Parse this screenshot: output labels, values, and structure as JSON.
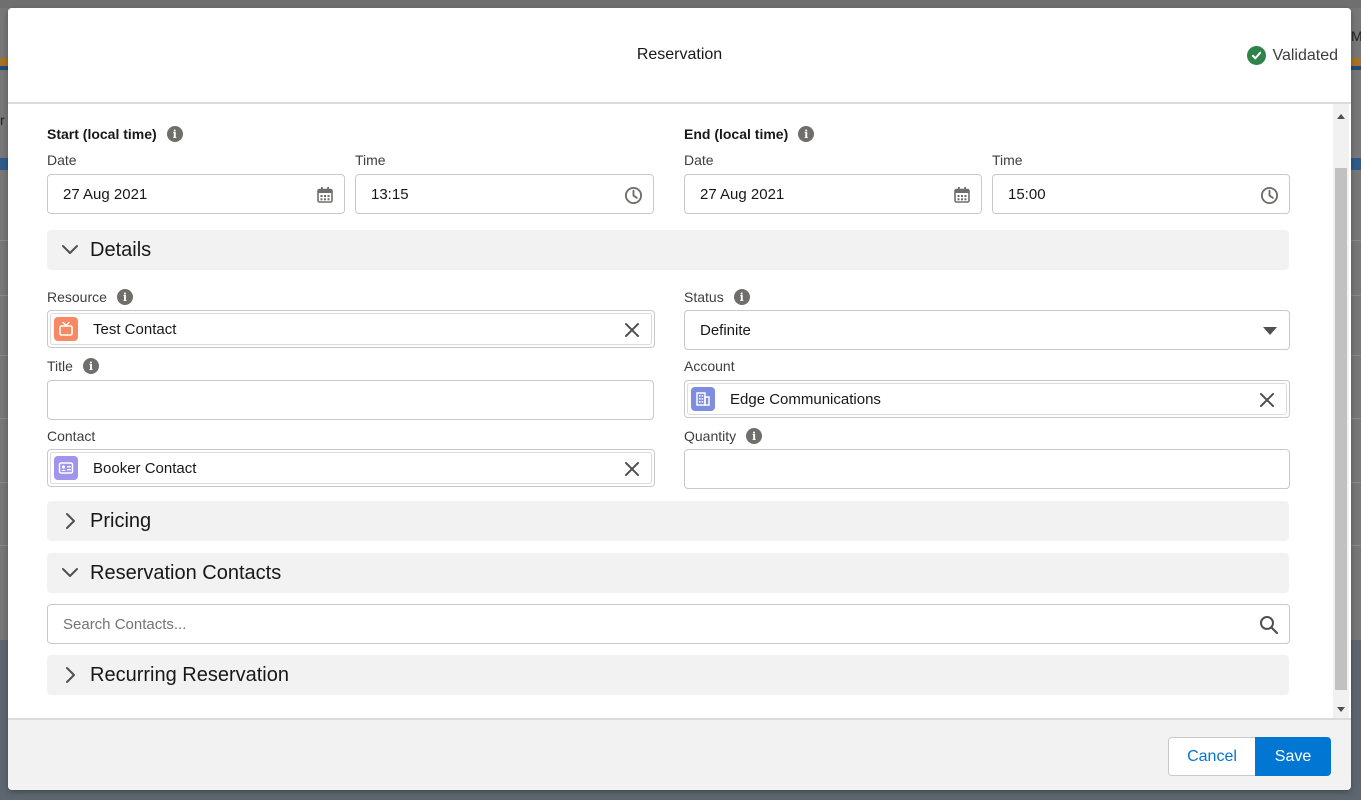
{
  "background": {
    "right_peek_text": "M",
    "left_peek_text": "r"
  },
  "modal": {
    "title": "Reservation",
    "status_text": "Validated"
  },
  "start": {
    "group_label": "Start (local time)",
    "date_label": "Date",
    "date_value": "27 Aug 2021",
    "time_label": "Time",
    "time_value": "13:15"
  },
  "end": {
    "group_label": "End (local time)",
    "date_label": "Date",
    "date_value": "27 Aug 2021",
    "time_label": "Time",
    "time_value": "15:00"
  },
  "details": {
    "section_title": "Details",
    "resource_label": "Resource",
    "resource_value": "Test Contact",
    "status_label": "Status",
    "status_value": "Definite",
    "title_label": "Title",
    "title_value": "",
    "account_label": "Account",
    "account_value": "Edge Communications",
    "contact_label": "Contact",
    "contact_value": "Booker Contact",
    "quantity_label": "Quantity",
    "quantity_value": ""
  },
  "pricing": {
    "section_title": "Pricing"
  },
  "reservation_contacts": {
    "section_title": "Reservation Contacts",
    "search_placeholder": "Search Contacts..."
  },
  "recurring": {
    "section_title": "Recurring Reservation"
  },
  "footer": {
    "cancel_label": "Cancel",
    "save_label": "Save"
  },
  "colors": {
    "brand_blue": "#0176d3",
    "validated_green": "#2e844a",
    "resource_icon": "#f88962",
    "account_icon": "#7f8de1",
    "contact_icon": "#a094ed",
    "section_bg": "#f3f2f2"
  }
}
